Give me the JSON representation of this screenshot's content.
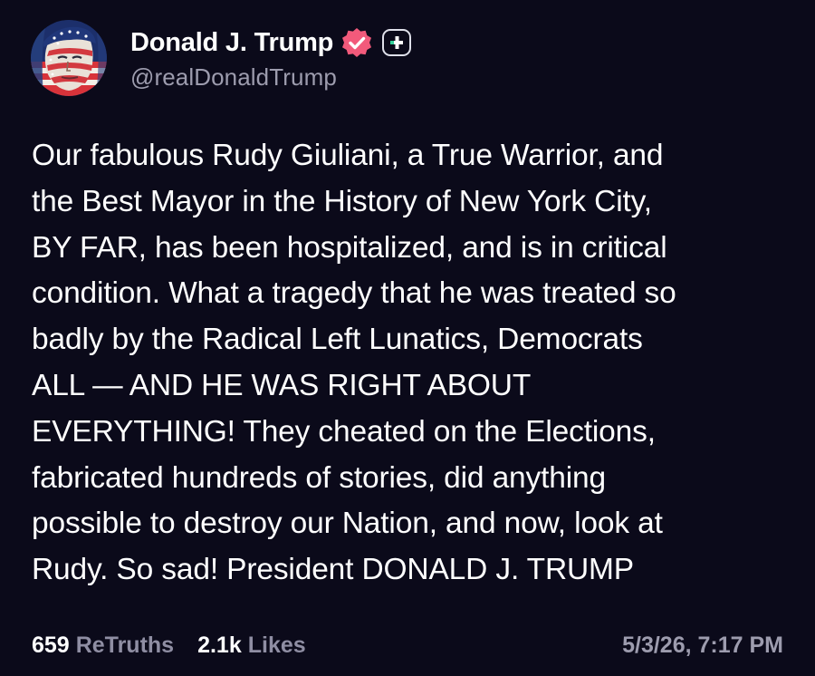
{
  "post": {
    "author": {
      "display_name": "Donald J. Trump",
      "handle": "@realDonaldTrump",
      "avatar_icon": "flag-portrait-avatar",
      "verified_icon": "verified-badge-icon",
      "plus_icon": "plus-badge-icon"
    },
    "text": "Our fabulous Rudy Giuliani, a True Warrior, and\nthe Best Mayor in the History of New York City,\nBY FAR, has been hospitalized, and is in critical\ncondition. What a tragedy that he was treated so\nbadly by the Radical Left Lunatics, Democrats\nALL — AND HE WAS RIGHT ABOUT\nEVERYTHING! They cheated on the Elections,\nfabricated hundreds of stories, did anything\npossible to destroy our Nation, and now, look at\nRudy. So sad! President DONALD J. TRUMP",
    "stats": {
      "retruths_count": "659",
      "retruths_label": "ReTruths",
      "likes_count": "2.1k",
      "likes_label": "Likes"
    },
    "timestamp": "5/3/26, 7:17 PM"
  },
  "colors": {
    "background": "#0b0a1a",
    "verified_badge": "#f25a7b",
    "secondary_text": "#9d9cae"
  }
}
